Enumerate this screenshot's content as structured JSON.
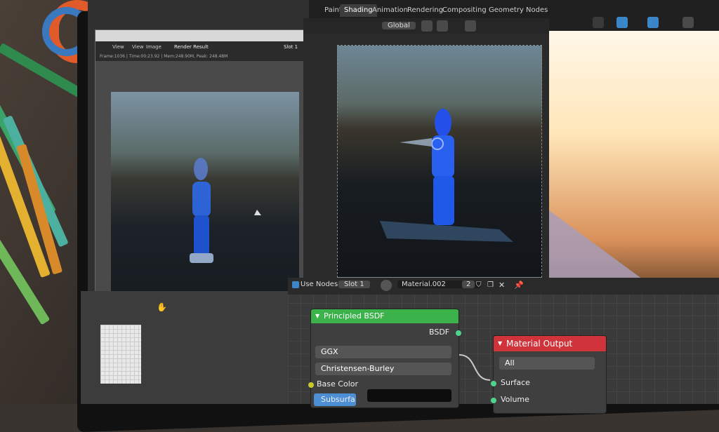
{
  "workspace_tabs": [
    "Paint",
    "Shading",
    "Animation",
    "Rendering",
    "Compositing",
    "Geometry Nodes"
  ],
  "active_tab": "Shading",
  "render_window": {
    "menu": [
      "View",
      "View",
      "Image"
    ],
    "image_name": "Render Result",
    "slot": "Slot 1",
    "info": "Frame:1036 | Time:00:23.92 | Mem:248.90M, Peak: 248.48M"
  },
  "viewport": {
    "orientation": "Global"
  },
  "node_editor": {
    "use_nodes_label": "Use Nodes",
    "slot": "Slot 1",
    "material": "Material.002",
    "users": "2"
  },
  "bsdf_node": {
    "title": "Principled BSDF",
    "output": "BSDF",
    "distribution": "GGX",
    "subsurface_method": "Christensen-Burley",
    "base_color_label": "Base Color",
    "subsurface_label": "Subsurfa"
  },
  "material_output_node": {
    "title": "Material Output",
    "target": "All",
    "inputs": [
      "Surface",
      "Volume"
    ]
  },
  "colors": {
    "bsdf_header": "#3bb34a",
    "output_header": "#d0343a",
    "active_tab_bg": "#3d3d3d"
  }
}
